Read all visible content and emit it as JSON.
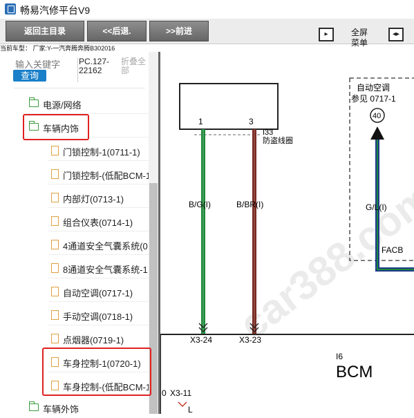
{
  "window": {
    "title": "畅易汽修平台V9"
  },
  "toolbar": {
    "back_main": "返回主目录",
    "back": "<<后退.",
    "forward": ">>前进",
    "fullscreen_line1": "全屏",
    "fullscreen_line2": "菜单"
  },
  "vehicle_info": "当前车型： 厂家:Y-一汽奔腾奔腾B302016",
  "search": {
    "placeholder": "输入关键字",
    "query_button": "查询",
    "code_line1": "PC.127-",
    "code_line2": "22162",
    "collapse_line1": "折叠全",
    "collapse_line2": "部"
  },
  "tree": {
    "top": {
      "label": "电源/网络",
      "icon": "folder-icon"
    },
    "group": {
      "label": "车辆内饰",
      "icon": "folder-icon"
    },
    "items": [
      {
        "label": "门锁控制-1(0711-1)"
      },
      {
        "label": "门锁控制-(低配BCM-1"
      },
      {
        "label": "内部灯(0713-1)"
      },
      {
        "label": "组合仪表(0714-1)"
      },
      {
        "label": "4通道安全气囊系统(0"
      },
      {
        "label": "8通道安全气囊系统-1"
      },
      {
        "label": "自动空调(0717-1)"
      },
      {
        "label": "手动空调(0718-1)"
      },
      {
        "label": "点烟器(0719-1)"
      },
      {
        "label": "车身控制-1(0720-1)"
      },
      {
        "label": "车身控制-(低配BCM-1"
      }
    ],
    "bottom": {
      "label": "车辆外饰",
      "icon": "folder-icon"
    }
  },
  "diagram": {
    "pin1": "1",
    "pin3": "3",
    "connector_i33": "I33",
    "antitheft": "防盗线圈",
    "wire_left": "B/G(I)",
    "wire_right": "B/BR(I)",
    "ac_label1": "自动空调",
    "ac_label2": "参见 0717-1",
    "ac_ref": "40",
    "wire_ac": "G/L(I)",
    "facb": "FACB",
    "conn_x3_24": "X3-24",
    "conn_x3_23": "X3-23",
    "module_code": "I6",
    "module_name": "BCM",
    "conn_x3_11": "X3-11",
    "edge_0": "0",
    "edge_L": "L",
    "watermark": "car388.com",
    "colors": {
      "green": "#1f8a3a",
      "brown": "#7a2a22",
      "blue": "#1e3a8a"
    }
  },
  "colors": {
    "accent": "#1a7fc9",
    "highlight": "#e02020"
  }
}
